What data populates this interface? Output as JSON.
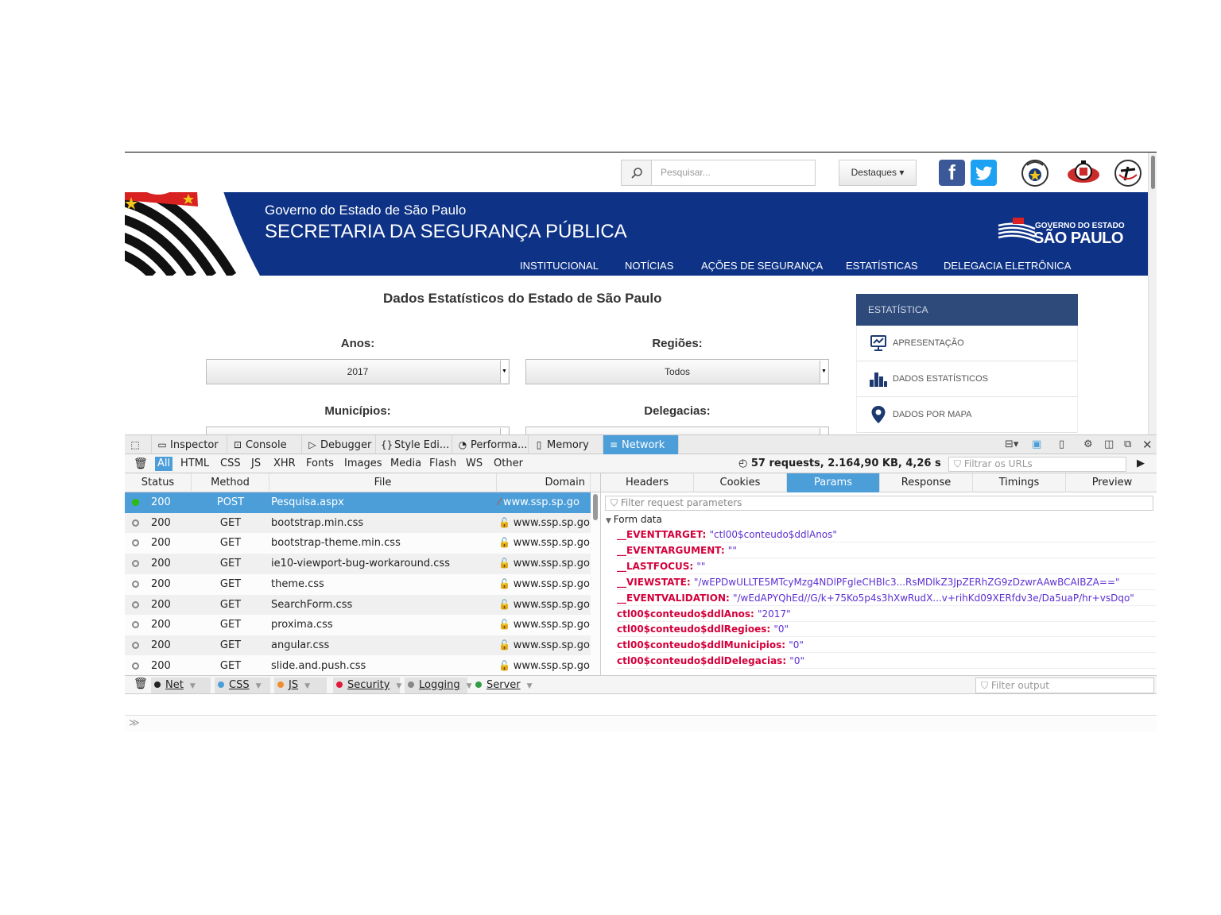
{
  "site": {
    "search_placeholder": "Pesquisar...",
    "destaques_label": "Destaques ▾",
    "header": {
      "gov_line": "Governo do Estado de São Paulo",
      "secretaria": "SECRETARIA DA SEGURANÇA PÚBLICA",
      "logo_small": "GOVERNO DO ESTADO",
      "logo_big": "SÃO PAULO"
    },
    "nav": [
      "INSTITUCIONAL",
      "NOTÍCIAS",
      "AÇÕES DE SEGURANÇA",
      "ESTATÍSTICAS",
      "DELEGACIA ELETRÔNICA"
    ],
    "title": "Dados Estatísticos do Estado de São Paulo",
    "filters": {
      "anos_label": "Anos:",
      "anos_value": "2017",
      "regioes_label": "Regiões:",
      "regioes_value": "Todos",
      "municipios_label": "Municípios:",
      "delegacias_label": "Delegacias:"
    },
    "sidebar": {
      "heading": "ESTATÍSTICA",
      "items": [
        "APRESENTAÇÃO",
        "DADOS ESTATÍSTICOS",
        "DADOS POR MAPA"
      ]
    },
    "colors": {
      "banner": "#0d3286",
      "sidebar_head": "#2e4a7b",
      "accent": "#4c9ed9"
    }
  },
  "devtools": {
    "tabs": [
      "Inspector",
      "Console",
      "Debugger",
      "Style Edi...",
      "Performa...",
      "Memory",
      "Network"
    ],
    "active_tab": "Network",
    "type_filters": [
      "All",
      "HTML",
      "CSS",
      "JS",
      "XHR",
      "Fonts",
      "Images",
      "Media",
      "Flash",
      "WS",
      "Other"
    ],
    "summary": "57 requests, 2.164,90 KB, 4,26 s",
    "url_filter_placeholder": "Filtrar os URLs",
    "columns": [
      "Status",
      "Method",
      "File",
      "Domain"
    ],
    "requests": [
      {
        "status": "200",
        "method": "POST",
        "file": "Pesquisa.aspx",
        "domain": "www.ssp.sp.go"
      },
      {
        "status": "200",
        "method": "GET",
        "file": "bootstrap.min.css",
        "domain": "www.ssp.sp.go"
      },
      {
        "status": "200",
        "method": "GET",
        "file": "bootstrap-theme.min.css",
        "domain": "www.ssp.sp.go"
      },
      {
        "status": "200",
        "method": "GET",
        "file": "ie10-viewport-bug-workaround.css",
        "domain": "www.ssp.sp.go"
      },
      {
        "status": "200",
        "method": "GET",
        "file": "theme.css",
        "domain": "www.ssp.sp.go"
      },
      {
        "status": "200",
        "method": "GET",
        "file": "SearchForm.css",
        "domain": "www.ssp.sp.go"
      },
      {
        "status": "200",
        "method": "GET",
        "file": "proxima.css",
        "domain": "www.ssp.sp.go"
      },
      {
        "status": "200",
        "method": "GET",
        "file": "angular.css",
        "domain": "www.ssp.sp.go"
      },
      {
        "status": "200",
        "method": "GET",
        "file": "slide.and.push.css",
        "domain": "www.ssp.sp.go"
      }
    ],
    "detail_tabs": [
      "Headers",
      "Cookies",
      "Params",
      "Response",
      "Timings",
      "Preview"
    ],
    "active_detail_tab": "Params",
    "param_filter_placeholder": "Filter request parameters",
    "form_data_label": "Form data",
    "params": [
      {
        "key": "__EVENTTARGET",
        "value": "\"ctl00$conteudo$ddlAnos\""
      },
      {
        "key": "__EVENTARGUMENT",
        "value": "\"\""
      },
      {
        "key": "__LASTFOCUS",
        "value": "\"\""
      },
      {
        "key": "__VIEWSTATE",
        "value": "\"/wEPDwULLTE5MTcyMzg4NDlPFgleCHBlc3...RsMDlkZ3JpZERhZG9zDzwrAAwBCAIBZA==\""
      },
      {
        "key": "__EVENTVALIDATION",
        "value": "\"/wEdAPYQhEd//G/k+75Ko5p4s3hXwRudX...v+rihKd09XERfdv3e/Da5uaP/hr+vsDqo\""
      },
      {
        "key": "ctl00$conteudo$ddlAnos",
        "value": "\"2017\""
      },
      {
        "key": "ctl00$conteudo$ddlRegioes",
        "value": "\"0\""
      },
      {
        "key": "ctl00$conteudo$ddlMunicipios",
        "value": "\"0\""
      },
      {
        "key": "ctl00$conteudo$ddlDelegacias",
        "value": "\"0\""
      }
    ],
    "console_categories": [
      {
        "label": "Net",
        "color": "#222222"
      },
      {
        "label": "CSS",
        "color": "#4c9ed9"
      },
      {
        "label": "JS",
        "color": "#f08d2c"
      },
      {
        "label": "Security",
        "color": "#e2183d"
      },
      {
        "label": "Logging",
        "color": "#888888"
      },
      {
        "label": "Server",
        "color": "#2f9e44"
      }
    ],
    "output_filter_placeholder": "Filter output",
    "prompt": "≫"
  }
}
